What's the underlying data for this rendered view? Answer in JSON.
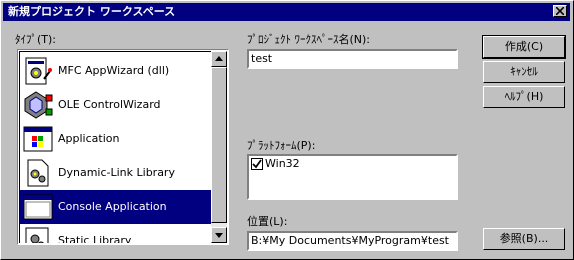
{
  "window": {
    "title": "新規プロジェクト ワークスペース"
  },
  "type_label": "ﾀｲﾌﾟ(T):",
  "project_types": [
    {
      "label": "MFC AppWizard (dll)",
      "icon": "mfc-appwizard-icon"
    },
    {
      "label": "OLE ControlWizard",
      "icon": "ole-control-icon"
    },
    {
      "label": "Application",
      "icon": "application-icon"
    },
    {
      "label": "Dynamic-Link Library",
      "icon": "dll-icon"
    },
    {
      "label": "Console Application",
      "icon": "console-icon",
      "selected": true
    },
    {
      "label": "Static Library",
      "icon": "static-library-icon"
    }
  ],
  "workspace_name": {
    "label": "ﾌﾟﾛｼﾞｪｸﾄ ﾜｰｸｽﾍﾟｰｽ名(N):",
    "value": "test"
  },
  "platform": {
    "label": "ﾌﾟﾗｯﾄﾌｫｰﾑ(P):",
    "items": [
      {
        "label": "Win32",
        "checked": true
      }
    ]
  },
  "location": {
    "label": "位置(L):",
    "value": "B:¥My Documents¥MyProgram¥test"
  },
  "buttons": {
    "create": "作成(C)",
    "cancel": "ｷｬﾝｾﾙ",
    "help": "ﾍﾙﾌﾟ(H)",
    "browse": "参照(B)..."
  },
  "colors": {
    "titlebar": "#000080",
    "selection": "#000080",
    "face": "#c0c0c0"
  }
}
